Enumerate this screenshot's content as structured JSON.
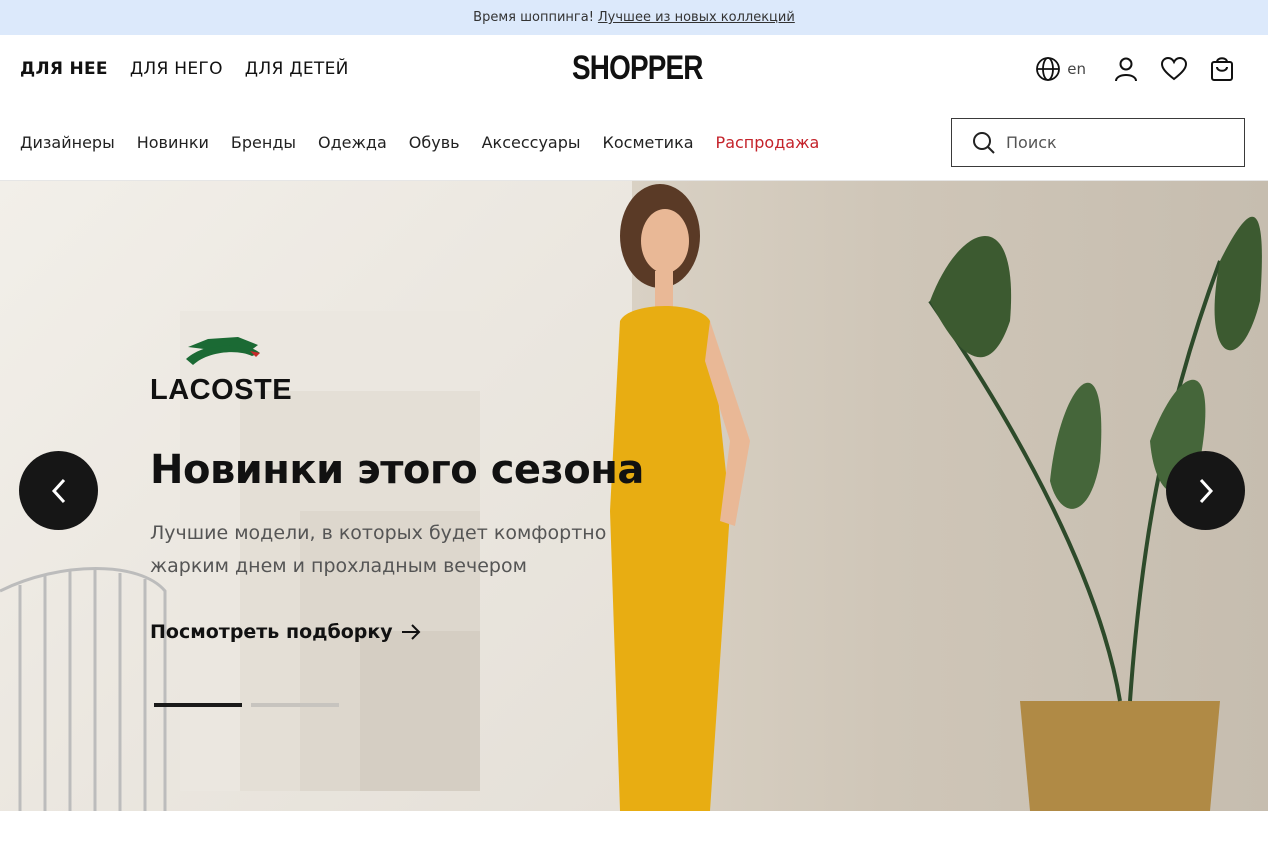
{
  "promo": {
    "text": "Время шоппинга!",
    "link": "Лучшее из новых коллекций"
  },
  "header": {
    "gender_nav": [
      "ДЛЯ НЕЕ",
      "ДЛЯ НЕГО",
      "ДЛЯ ДЕТЕЙ"
    ],
    "logo": "SHOPPER",
    "language": "en",
    "categories": [
      "Дизайнеры",
      "Новинки",
      "Бренды",
      "Одежда",
      "Обувь",
      "Аксессуары",
      "Косметика",
      "Распродажа"
    ],
    "search_placeholder": "Поиск"
  },
  "hero": {
    "brand": "LACOSTE",
    "title": "Новинки этого сезона",
    "subtitle": "Лучшие модели, в которых будет комфортно жарким днем и прохладным вечером",
    "cta": "Посмотреть подборку",
    "slides_count": 2,
    "active_slide": 1
  },
  "colors": {
    "promo_bg": "#dce9fb",
    "sale": "#c4222a",
    "arrow_bg": "#161616"
  },
  "icons": [
    "globe-icon",
    "user-icon",
    "heart-icon",
    "bag-icon",
    "search-icon",
    "chevron-left-icon",
    "chevron-right-icon",
    "arrow-right-icon",
    "crocodile-icon"
  ]
}
